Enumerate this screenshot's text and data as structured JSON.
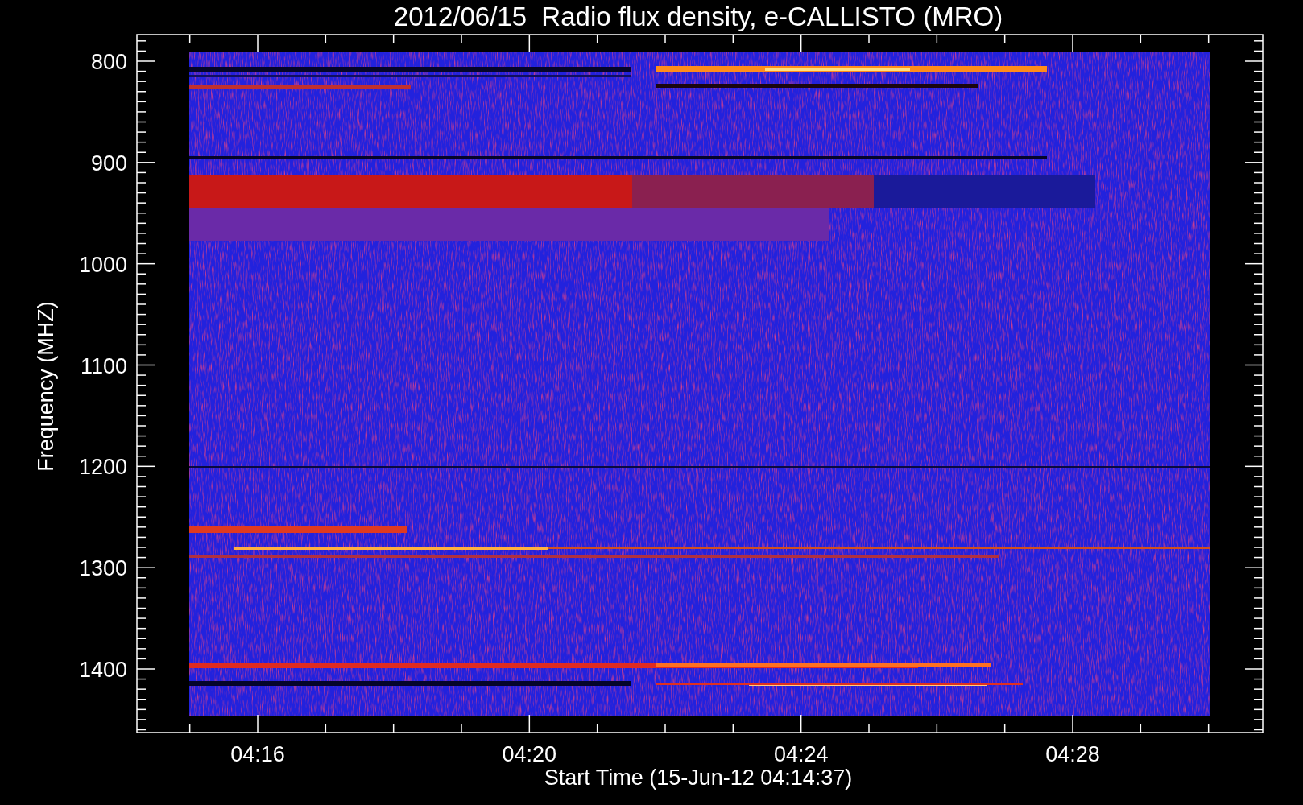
{
  "title": "2012/06/15  Radio flux density, e-CALLISTO (MRO)",
  "y_axis": {
    "label": "Frequency (MHZ)",
    "ticks": [
      "800",
      "900",
      "1000",
      "1100",
      "1200",
      "1300",
      "1400"
    ]
  },
  "x_axis": {
    "label": "Start Time (15-Jun-12 04:14:37)",
    "ticks": [
      "04:16",
      "04:20",
      "04:24",
      "04:28"
    ]
  }
}
